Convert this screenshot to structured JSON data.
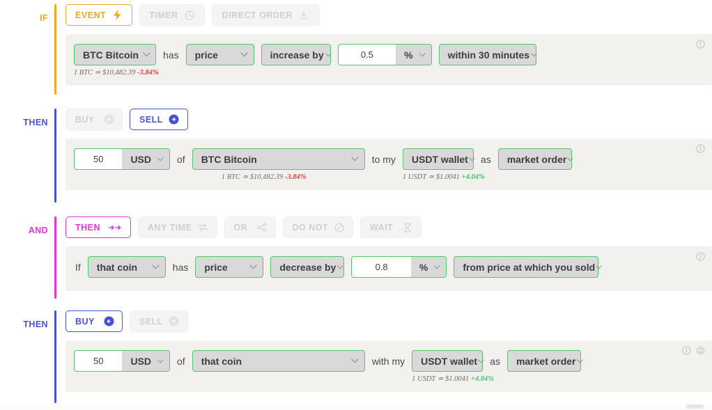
{
  "colors": {
    "if_accent": "#f5a623",
    "then_accent": "#4950d8",
    "and_accent": "#ef2fe0",
    "field_border": "#55c46e",
    "field_bg": "#d9d9d9",
    "panel_bg": "#f2f1ee",
    "price_down": "#e8413a",
    "price_up": "#45c463"
  },
  "blocks": [
    {
      "label": "IF",
      "tabs": [
        {
          "label": "EVENT",
          "icon": "lightning-icon",
          "state": "active"
        },
        {
          "label": "TIMER",
          "icon": "clock-icon",
          "state": "disabled"
        },
        {
          "label": "DIRECT ORDER",
          "icon": "download-icon",
          "state": "disabled"
        }
      ],
      "fields": {
        "coin": "BTC Bitcoin",
        "conj_has": "has",
        "metric": "price",
        "direction": "increase by",
        "amount": "0.5",
        "unit": "%",
        "timeframe": "within 30 minutes"
      },
      "hint": {
        "text": "1 BTC ≃ $10,482.39 ",
        "change": "-3.84%",
        "dir": "down"
      }
    },
    {
      "label": "THEN",
      "tabs": [
        {
          "label": "BUY",
          "icon": "arrow-left-circle-icon",
          "state": "disabled"
        },
        {
          "label": "SELL",
          "icon": "arrow-right-circle-icon",
          "state": "active"
        }
      ],
      "fields": {
        "amount": "50",
        "currency": "USD",
        "conj_of": "of",
        "coin": "BTC Bitcoin",
        "conj_to": "to my",
        "wallet": "USDT wallet",
        "conj_as": "as",
        "order_type": "market order"
      },
      "hint": {
        "text": "1 BTC ≃ $10,482.39 ",
        "change": "-3.84%",
        "dir": "down"
      },
      "hint2": {
        "text": "1 USDT ≃ $1.0041 ",
        "change": "+4.04%",
        "dir": "up"
      }
    },
    {
      "label": "AND",
      "tabs": [
        {
          "label": "THEN",
          "icon": "double-arrow-right-icon",
          "state": "active"
        },
        {
          "label": "ANY TIME",
          "icon": "shuffle-icon",
          "state": "disabled"
        },
        {
          "label": "OR",
          "icon": "branch-icon",
          "state": "disabled"
        },
        {
          "label": "DO NOT",
          "icon": "block-icon",
          "state": "disabled"
        },
        {
          "label": "WAIT",
          "icon": "hourglass-icon",
          "state": "disabled"
        }
      ],
      "fields": {
        "conj_if": "If",
        "coin": "that coin",
        "conj_has": "has",
        "metric": "price",
        "direction": "decrease by",
        "amount": "0.8",
        "unit": "%",
        "reference": "from price at which you sold"
      }
    },
    {
      "label": "THEN",
      "tabs": [
        {
          "label": "BUY",
          "icon": "arrow-left-circle-icon",
          "state": "active"
        },
        {
          "label": "SELL",
          "icon": "arrow-right-circle-icon",
          "state": "disabled"
        }
      ],
      "fields": {
        "amount": "50",
        "currency": "USD",
        "conj_of": "of",
        "coin": "that coin",
        "conj_with": "with my",
        "wallet": "USDT wallet",
        "conj_as": "as",
        "order_type": "market order"
      },
      "hint2": {
        "text": "1 USDT ≃ $1.0041 ",
        "change": "+4.04%",
        "dir": "up"
      }
    }
  ],
  "icons": {
    "info": "info-icon",
    "remove": "minus-circle-icon"
  }
}
